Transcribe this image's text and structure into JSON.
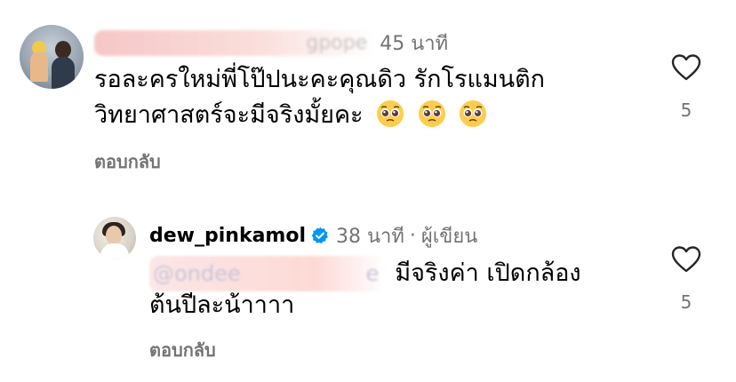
{
  "comments": [
    {
      "username_visible": "gpope",
      "timestamp": "45 นาที",
      "text_line1": "รอละครใหม่พี่โป๊ปนะคะคุณดิว รักโรแมนติก",
      "text_line2": "วิทยาศาสตร์จะมีจริงมั้ยคะ",
      "emoji": [
        "🥺",
        "🥺",
        "🥺"
      ],
      "reply_label": "ตอบกลับ",
      "like_count": "5",
      "avatar_icon": "profile-photo-couple"
    },
    {
      "username": "dew_pinkamol",
      "verified_icon": "verified-badge-icon",
      "timestamp": "38 นาที",
      "separator": "·",
      "author_tag": "ผู้เขียน",
      "mention_visible": "@ondee",
      "mention_suffix": "e",
      "text_line1": "มีจริงค่า เปิดกล้อง",
      "text_line2": "ต้นปีละน้าาาา",
      "reply_label": "ตอบกลับ",
      "like_count": "5",
      "avatar_icon": "profile-photo-woman"
    }
  ],
  "colors": {
    "secondary_text": "#737373",
    "verified_blue": "#0095f6",
    "heart_outline": "#262626"
  }
}
